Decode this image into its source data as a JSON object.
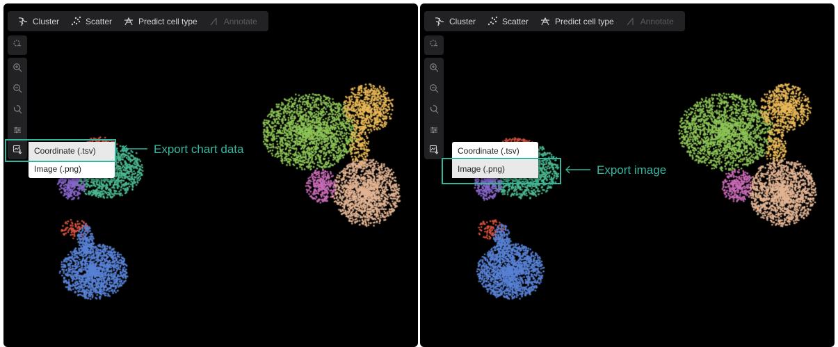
{
  "toolbar": {
    "cluster": "Cluster",
    "scatter": "Scatter",
    "predict": "Predict cell type",
    "annotate": "Annotate"
  },
  "menu": {
    "coordinate": "Coordinate (.tsv)",
    "image": "Image (.png)"
  },
  "callouts": {
    "left": "Export chart data",
    "right": "Export image"
  },
  "colors": {
    "accent": "#36b6a0",
    "cluster_green": "#8cc356",
    "cluster_yellow": "#e8b858",
    "cluster_peach": "#e2b493",
    "cluster_pink": "#c86bb6",
    "cluster_teal": "#4cb990",
    "cluster_purple": "#8967cc",
    "cluster_red": "#d9533f",
    "cluster_blue": "#5881d4"
  },
  "icons": [
    "cluster-icon",
    "scatter-icon",
    "predict-cell-type-icon",
    "annotate-icon",
    "lasso-select-icon",
    "zoom-in-icon",
    "zoom-out-icon",
    "reset-zoom-icon",
    "settings-sliders-icon",
    "export-icon",
    "arrow-left-icon"
  ]
}
